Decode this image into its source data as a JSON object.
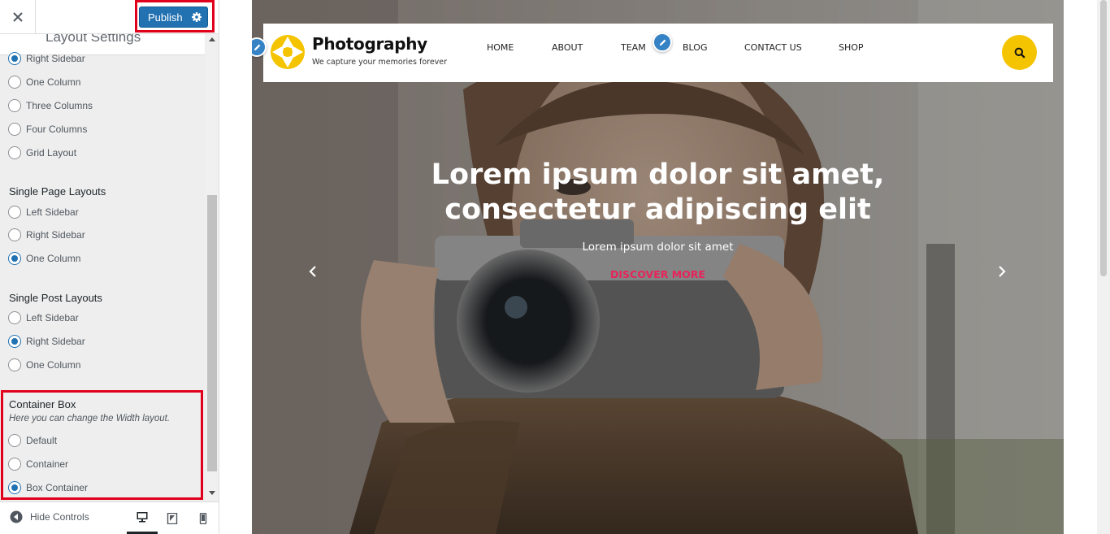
{
  "customizer": {
    "publish_label": "Publish",
    "section_title": "Layout Settings",
    "archive_layout": {
      "options": [
        "Right Sidebar",
        "One Column",
        "Three Columns",
        "Four Columns",
        "Grid Layout"
      ],
      "selected": "Right Sidebar"
    },
    "single_page": {
      "title": "Single Page Layouts",
      "options": [
        "Left Sidebar",
        "Right Sidebar",
        "One Column"
      ],
      "selected": "One Column"
    },
    "single_post": {
      "title": "Single Post Layouts",
      "options": [
        "Left Sidebar",
        "Right Sidebar",
        "One Column"
      ],
      "selected": "Right Sidebar"
    },
    "container_box": {
      "title": "Container Box",
      "description": "Here you can change the Width layout.",
      "options": [
        "Default",
        "Container",
        "Box Container"
      ],
      "selected": "Box Container"
    },
    "footer": {
      "hide_controls_label": "Hide Controls",
      "active_device": "desktop"
    },
    "colors": {
      "accent": "#2271b1",
      "highlight": "#e0001b"
    }
  },
  "site": {
    "title": "Photography",
    "tagline": "We capture your memories forever",
    "nav": [
      "HOME",
      "ABOUT",
      "TEAM",
      "BLOG",
      "CONTACT US",
      "SHOP"
    ],
    "slide": {
      "heading_line1": "Lorem ipsum dolor sit amet,",
      "heading_line2": "consectetur adipiscing elit",
      "subtitle": "Lorem ipsum dolor sit amet",
      "cta": "DISCOVER MORE"
    },
    "colors": {
      "logo": "#f5c400",
      "search_button": "#f5c400",
      "cta": "#e8245a"
    }
  },
  "icons": {
    "close": "close-icon",
    "publish_settings": "gear-icon",
    "hide_controls": "collapse-arrow-icon",
    "devices": [
      "desktop-icon",
      "tablet-icon",
      "mobile-icon"
    ],
    "edit_shortcut": "pencil-icon",
    "search": "search-icon",
    "slider_prev": "chevron-left-icon",
    "slider_next": "chevron-right-icon"
  }
}
